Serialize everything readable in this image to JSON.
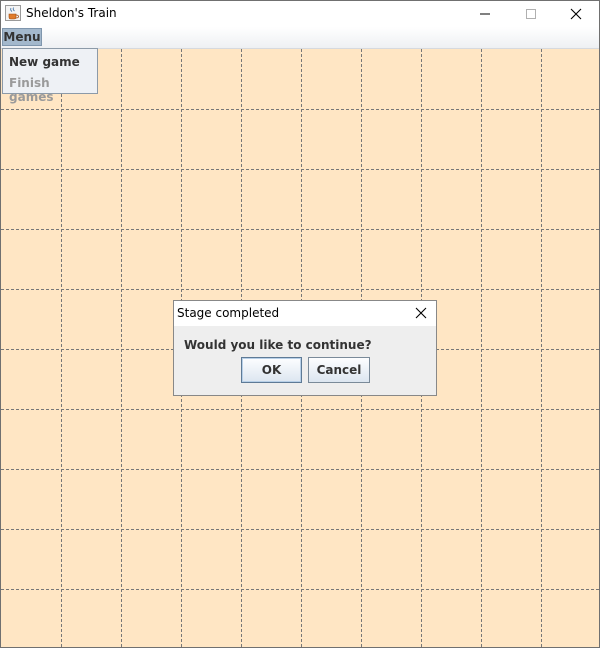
{
  "window": {
    "title": "Sheldon's Train",
    "icon": "java-cup-icon",
    "controls": [
      "minimize-icon",
      "maximize-icon",
      "close-icon"
    ]
  },
  "menubar": {
    "items": [
      {
        "label": "Menu",
        "open": true
      }
    ]
  },
  "dropdown": {
    "items": [
      {
        "label": "New game",
        "enabled": true
      },
      {
        "label": "Finish games",
        "enabled": false
      }
    ]
  },
  "board": {
    "background_color": "#ffe6c4",
    "grid_line_color": "#777777",
    "grid_style": "dashed",
    "columns": 10,
    "rows": 10
  },
  "dialog": {
    "title": "Stage completed",
    "message": "Would you like to continue?",
    "ok_label": "OK",
    "cancel_label": "Cancel",
    "default_button": "OK"
  }
}
